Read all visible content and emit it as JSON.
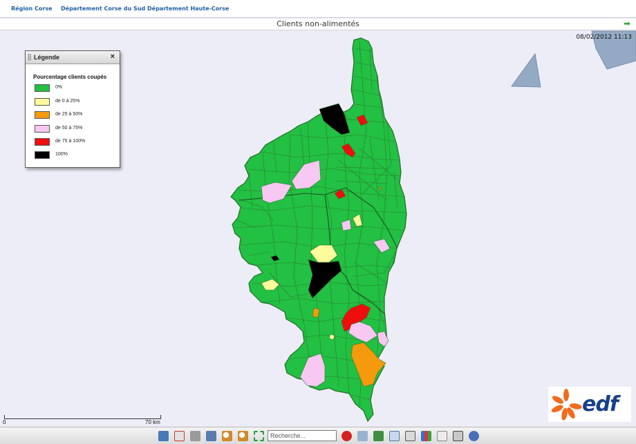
{
  "nav": {
    "items": [
      "Région Corse",
      "Département Corse du Sud",
      "Département Haute-Corse"
    ]
  },
  "title": "Clients non-alimentés",
  "datetime": "08/02/2012 11:13",
  "legend": {
    "title": "Légende",
    "close": "×",
    "subtitle": "Pourcentage clients coupés",
    "items": [
      {
        "label": "0%",
        "color": "#22c043"
      },
      {
        "label": "de 0 à 25%",
        "color": "#fdfb9c"
      },
      {
        "label": "de 25 à 50%",
        "color": "#f59a0c"
      },
      {
        "label": "de 50 à 75%",
        "color": "#f6c8f2"
      },
      {
        "label": "de 75 à 100%",
        "color": "#ee0e0e"
      },
      {
        "label": "100%",
        "color": "#000000"
      }
    ]
  },
  "scale": {
    "start": "0",
    "end": "70 km"
  },
  "logo": {
    "text": "edf"
  },
  "toolbar": {
    "search_placeholder": "Recherche...",
    "icons": [
      "save-icon",
      "pdf-icon",
      "print-icon",
      "export-icon",
      "zoom-in-icon",
      "zoom-out-icon",
      "full-extent-icon",
      "clear-search-icon",
      "copy-icon",
      "tree-icon",
      "layout-icon",
      "panel-icon",
      "chart-icon",
      "report-icon",
      "layers-icon",
      "info-icon"
    ]
  },
  "colors": {
    "land": "#22c043",
    "border": "#2d7a2d",
    "sea": "#ecedf7",
    "other_land": "#94aac4"
  }
}
